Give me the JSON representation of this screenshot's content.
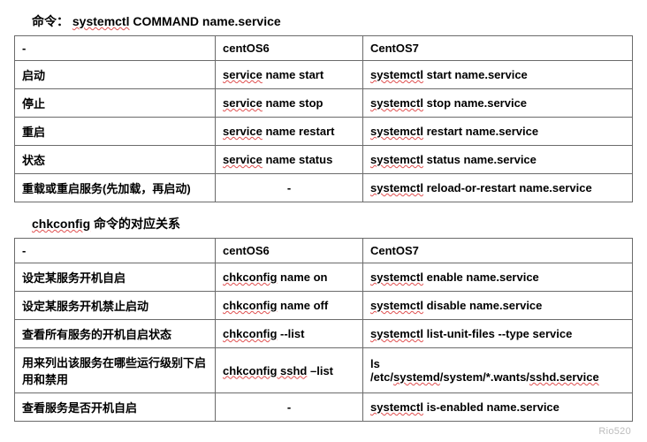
{
  "heading1_prefix": "命令：   ",
  "heading1_cmd": "systemctl",
  "heading1_rest": " COMMAND   name.service",
  "table1": {
    "header": {
      "c1": "-",
      "c2": "centOS6",
      "c3": "CentOS7"
    },
    "rows": [
      {
        "c1": "启动",
        "c2_a": "service",
        "c2_b": " name start",
        "c3_a": "systemctl",
        "c3_b": " start name.service"
      },
      {
        "c1": "停止",
        "c2_a": "service",
        "c2_b": " name  stop",
        "c3_a": "systemctl",
        "c3_b": " stop name.service"
      },
      {
        "c1": "重启",
        "c2_a": "service",
        "c2_b": " name restart",
        "c3_a": "systemctl",
        "c3_b": " restart name.service"
      },
      {
        "c1": "状态",
        "c2_a": "service",
        "c2_b": " name status",
        "c3_a": "systemctl",
        "c3_b": " status name.service"
      },
      {
        "c1": "重载或重启服务(先加载，再启动)",
        "c2_plain": "-",
        "c3_a": "systemctl",
        "c3_b": " reload-or-restart name.service"
      }
    ]
  },
  "heading2_indent": "    ",
  "heading2_a": "chkconfig",
  "heading2_b": " 命令的对应关系",
  "table2": {
    "header": {
      "c1": "-",
      "c2": "centOS6",
      "c3": "CentOS7"
    },
    "rows": [
      {
        "c1": "设定某服务开机自启",
        "c2_a": "chkconfig",
        "c2_b": " name on",
        "c3_a": "systemctl",
        "c3_b": " enable name.service"
      },
      {
        "c1": "设定某服务开机禁止启动",
        "c2_a": "chkconfig",
        "c2_b": " name off",
        "c3_a": "systemctl",
        "c3_b": " disable name.service"
      },
      {
        "c1": "查看所有服务的开机自启状态",
        "c2_a": "chkconfig",
        "c2_b": " --list",
        "c3_a": "systemctl",
        "c3_b": " list-unit-files --type service"
      },
      {
        "c1": "用来列出该服务在哪些运行级别下启用和禁用",
        "c2_a": "chkconfig",
        "c2_b_a": " sshd",
        "c2_b_b": " –list",
        "c3_line1": "ls",
        "c3_line2_a": "/etc/",
        "c3_line2_b": "systemd",
        "c3_line2_c": "/system/*.wants/",
        "c3_line2_d": "sshd.service"
      },
      {
        "c1": "查看服务是否开机自启",
        "c2_plain": "-",
        "c3_a": "systemctl",
        "c3_b": " is-enabled name.service"
      }
    ]
  },
  "watermark_text": "Rio520"
}
